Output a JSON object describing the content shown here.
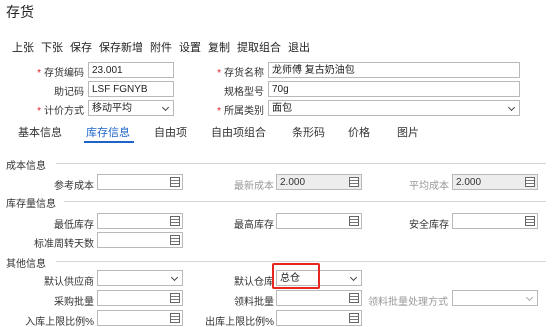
{
  "window": {
    "title": "存货"
  },
  "toolbar": [
    "上张",
    "下张",
    "保存",
    "保存新增",
    "附件",
    "设置",
    "复制",
    "提取组合",
    "退出"
  ],
  "header": {
    "code_label": "存货编码",
    "code_value": "23.001",
    "name_label": "存货名称",
    "name_value": "龙师傅 复古奶油包",
    "mnemonic_label": "助记码",
    "mnemonic_value": "LSF FGNYB",
    "spec_label": "规格型号",
    "spec_value": "70g",
    "pricing_label": "计价方式",
    "pricing_value": "移动平均",
    "category_label": "所属类别",
    "category_value": "面包"
  },
  "tabs": [
    "基本信息",
    "库存信息",
    "自由项",
    "自由项组合",
    "条形码",
    "价格",
    "图片"
  ],
  "active_tab": "库存信息",
  "cost": {
    "section": "成本信息",
    "reference_label": "参考成本",
    "reference_value": "",
    "latest_label": "最新成本",
    "latest_value": "2.000",
    "average_label": "平均成本",
    "average_value": "2.000"
  },
  "stock": {
    "section": "库存量信息",
    "min_label": "最低库存",
    "min_value": "",
    "max_label": "最高库存",
    "max_value": "",
    "safety_label": "安全库存",
    "safety_value": "",
    "turnover_label": "标准周转天数",
    "turnover_value": ""
  },
  "other": {
    "section": "其他信息",
    "supplier_label": "默认供应商",
    "supplier_value": "",
    "warehouse_label": "默认仓库",
    "warehouse_value": "总仓",
    "purchase_batch_label": "采购批量",
    "purchase_batch_value": "",
    "pick_batch_label": "领料批量",
    "pick_batch_value": "",
    "pick_batch_method_label": "领料批量处理方式",
    "pick_batch_method_value": "",
    "inbound_limit_label": "入库上限比例%",
    "inbound_limit_value": "",
    "outbound_limit_label": "出库上限比例%",
    "outbound_limit_value": ""
  },
  "colors": {
    "accent": "#1e64c8",
    "required": "#e02020",
    "highlight": "#e8251e"
  }
}
